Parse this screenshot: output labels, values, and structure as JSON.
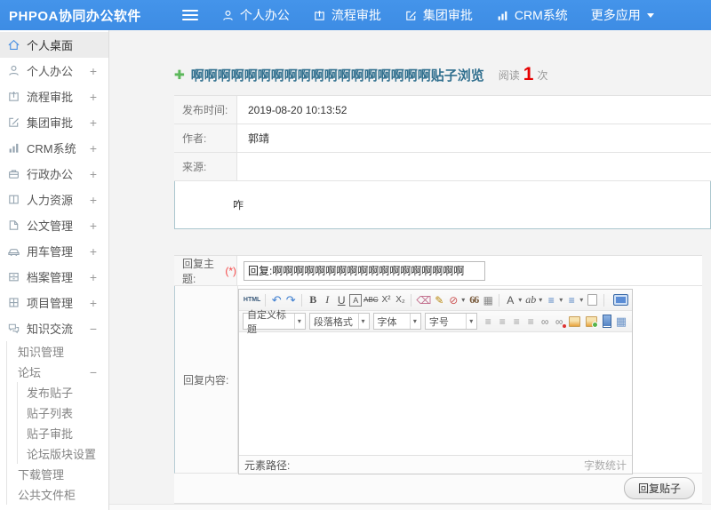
{
  "navbar": {
    "brand": "PHPOA协同办公软件",
    "items": [
      {
        "label": "个人办公",
        "icon": "user-icon"
      },
      {
        "label": "流程审批",
        "icon": "workflow-icon"
      },
      {
        "label": "集团审批",
        "icon": "edit-icon"
      },
      {
        "label": "CRM系统",
        "icon": "chart-icon"
      },
      {
        "label": "更多应用",
        "icon": "caret-down-icon"
      }
    ]
  },
  "sidebar": {
    "items": [
      {
        "label": "个人桌面",
        "icon": "home-icon",
        "selected": true
      },
      {
        "label": "个人办公",
        "icon": "user-icon",
        "toggle": "+"
      },
      {
        "label": "流程审批",
        "icon": "workflow-icon",
        "toggle": "+"
      },
      {
        "label": "集团审批",
        "icon": "edit-icon",
        "toggle": "+"
      },
      {
        "label": "CRM系统",
        "icon": "chart-icon",
        "toggle": "+"
      },
      {
        "label": "行政办公",
        "icon": "briefcase-icon",
        "toggle": "+"
      },
      {
        "label": "人力资源",
        "icon": "book-icon",
        "toggle": "+"
      },
      {
        "label": "公文管理",
        "icon": "document-icon",
        "toggle": "+"
      },
      {
        "label": "用车管理",
        "icon": "car-icon",
        "toggle": "+"
      },
      {
        "label": "档案管理",
        "icon": "archive-icon",
        "toggle": "+"
      },
      {
        "label": "项目管理",
        "icon": "project-icon",
        "toggle": "+"
      },
      {
        "label": "知识交流",
        "icon": "chat-icon",
        "toggle": "−"
      }
    ],
    "subs": [
      {
        "label": "知识管理"
      },
      {
        "label": "论坛",
        "toggle": "−"
      },
      {
        "label": "发布贴子"
      },
      {
        "label": "贴子列表"
      },
      {
        "label": "贴子审批"
      },
      {
        "label": "论坛版块设置"
      },
      {
        "label": "下载管理"
      },
      {
        "label": "公共文件柜"
      }
    ]
  },
  "post": {
    "title": "啊啊啊啊啊啊啊啊啊啊啊啊啊啊啊啊啊啊贴子浏览",
    "read_label": "阅读",
    "read_count": "1",
    "read_unit": "次",
    "fields": [
      {
        "label": "发布时间:",
        "value": "2019-08-20 10:13:52"
      },
      {
        "label": "作者:",
        "value": "郭靖"
      },
      {
        "label": "来源:",
        "value": ""
      }
    ],
    "content": "咋"
  },
  "reply": {
    "subject_label": "回复主题:",
    "required": "(*)",
    "subject_value": "回复:啊啊啊啊啊啊啊啊啊啊啊啊啊啊啊啊啊啊",
    "content_label": "回复内容:",
    "submit": "回复贴子"
  },
  "editor": {
    "row1": [
      {
        "name": "source-code",
        "glyph": "HTML"
      },
      {
        "name": "undo",
        "glyph": "↶"
      },
      {
        "name": "redo",
        "glyph": "↷"
      },
      {
        "name": "bold",
        "glyph": "B"
      },
      {
        "name": "italic",
        "glyph": "I"
      },
      {
        "name": "underline",
        "glyph": "U"
      },
      {
        "name": "font-border",
        "glyph": "A"
      },
      {
        "name": "strikethrough",
        "glyph": "ABC"
      },
      {
        "name": "superscript",
        "glyph": "X²"
      },
      {
        "name": "subscript",
        "glyph": "X₂"
      },
      {
        "name": "eraser",
        "glyph": "⌫"
      },
      {
        "name": "format-painter",
        "glyph": "✎"
      },
      {
        "name": "remove-format",
        "glyph": "⊘"
      },
      {
        "name": "blockquote",
        "glyph": "66"
      },
      {
        "name": "insert-date",
        "glyph": "▦"
      },
      {
        "name": "font-color",
        "glyph": "A"
      },
      {
        "name": "highlight",
        "glyph": "ab"
      },
      {
        "name": "ordered-list",
        "glyph": "≡"
      },
      {
        "name": "unordered-list",
        "glyph": "≡"
      }
    ],
    "selects": [
      "自定义标题",
      "段落格式",
      "字体",
      "字号"
    ],
    "row2": [
      {
        "name": "align-left",
        "glyph": "≡"
      },
      {
        "name": "align-center",
        "glyph": "≡"
      },
      {
        "name": "align-right",
        "glyph": "≡"
      },
      {
        "name": "align-justify",
        "glyph": "≡"
      },
      {
        "name": "link",
        "glyph": "∞"
      },
      {
        "name": "anchor",
        "glyph": "∞"
      },
      {
        "name": "insert-table",
        "glyph": "▦"
      }
    ],
    "path_label": "元素路径:",
    "wordcount_label": "字数统计"
  },
  "colors": {
    "navbar_blue": "#3e8ee6",
    "accent_blue": "#4a90e2",
    "title_teal": "#31708f",
    "count_red": "#e60000",
    "plus_green": "#5cb85c"
  }
}
